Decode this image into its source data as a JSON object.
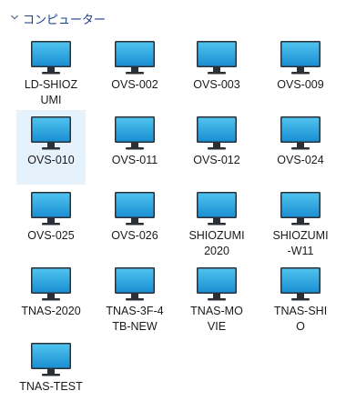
{
  "group": {
    "title": "コンピューター"
  },
  "computers": [
    {
      "name": "LD-SHIOZUMI",
      "label": "LD-SHIOZ\nUMI",
      "selected": false
    },
    {
      "name": "OVS-002",
      "label": "OVS-002",
      "selected": false
    },
    {
      "name": "OVS-003",
      "label": "OVS-003",
      "selected": false
    },
    {
      "name": "OVS-009",
      "label": "OVS-009",
      "selected": false
    },
    {
      "name": "OVS-010",
      "label": "OVS-010",
      "selected": true
    },
    {
      "name": "OVS-011",
      "label": "OVS-011",
      "selected": false
    },
    {
      "name": "OVS-012",
      "label": "OVS-012",
      "selected": false
    },
    {
      "name": "OVS-024",
      "label": "OVS-024",
      "selected": false
    },
    {
      "name": "OVS-025",
      "label": "OVS-025",
      "selected": false
    },
    {
      "name": "OVS-026",
      "label": "OVS-026",
      "selected": false
    },
    {
      "name": "SHIOZUMI2020",
      "label": "SHIOZUMI\n2020",
      "selected": false
    },
    {
      "name": "SHIOZUMI-W11",
      "label": "SHIOZUMI\n-W11",
      "selected": false
    },
    {
      "name": "TNAS-2020",
      "label": "TNAS-2020",
      "selected": false
    },
    {
      "name": "TNAS-3F-4TB-NEW",
      "label": "TNAS-3F-4\nTB-NEW",
      "selected": false
    },
    {
      "name": "TNAS-MOVIE",
      "label": "TNAS-MO\nVIE",
      "selected": false
    },
    {
      "name": "TNAS-SHIO",
      "label": "TNAS-SHI\nO",
      "selected": false
    },
    {
      "name": "TNAS-TEST",
      "label": "TNAS-TEST",
      "selected": false
    }
  ],
  "icon": {
    "name": "monitor-icon",
    "screen_top": "#4fc3ee",
    "screen_bottom": "#1a8fd3",
    "bezel": "#2b2f36",
    "stand": "#2b2f36"
  },
  "colors": {
    "header_text": "#1a3e8c",
    "selection_bg": "#e5f1fb"
  }
}
